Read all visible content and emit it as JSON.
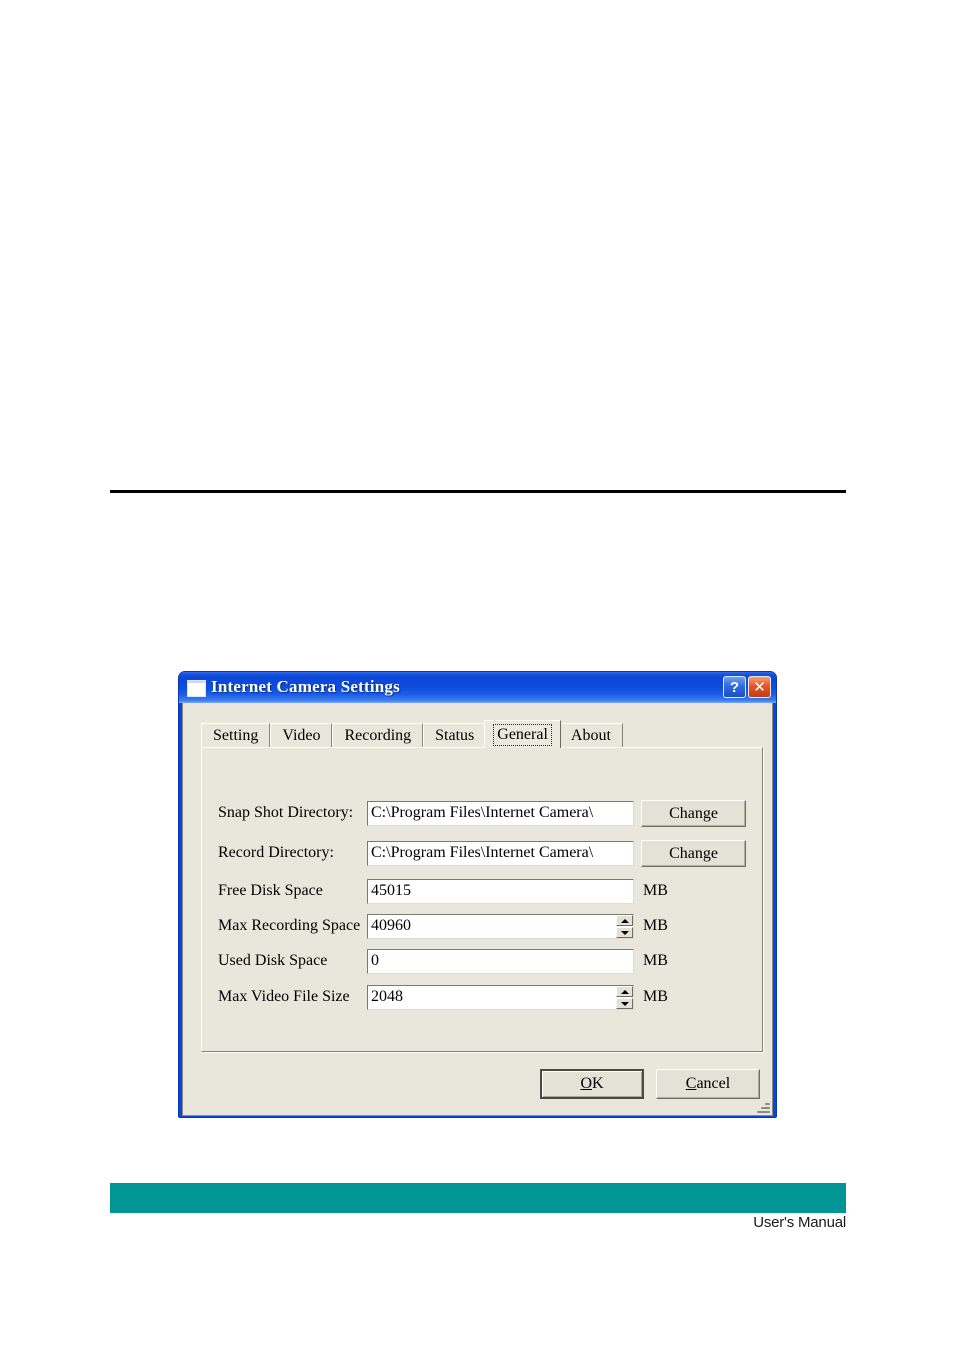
{
  "page": {
    "footer_label": "User's Manual",
    "footer_bar_color": "#019596"
  },
  "dialog": {
    "title": "Internet Camera Settings",
    "window_icon": "window-icon",
    "help_button": "?",
    "close_button": "✕",
    "tabs": [
      {
        "label": "Setting",
        "selected": false
      },
      {
        "label": "Video",
        "selected": false
      },
      {
        "label": "Recording",
        "selected": false
      },
      {
        "label": "Status",
        "selected": false
      },
      {
        "label": "General",
        "selected": true
      },
      {
        "label": "About",
        "selected": false
      }
    ],
    "fields": [
      {
        "label": "Snap Shot Directory:",
        "value": "C:\\Program Files\\Internet Camera\\",
        "unit": "",
        "button": "Change",
        "spinner": false
      },
      {
        "label": "Record Directory:",
        "value": "C:\\Program Files\\Internet Camera\\",
        "unit": "",
        "button": "Change",
        "spinner": false
      },
      {
        "label": "Free Disk Space",
        "value": "45015",
        "unit": "MB",
        "button": "",
        "spinner": false
      },
      {
        "label": "Max Recording Space",
        "value": "40960",
        "unit": "MB",
        "button": "",
        "spinner": true
      },
      {
        "label": "Used Disk Space",
        "value": "0",
        "unit": "MB",
        "button": "",
        "spinner": false
      },
      {
        "label": "Max Video File Size",
        "value": "2048",
        "unit": "MB",
        "button": "",
        "spinner": true
      }
    ],
    "actions": {
      "ok": {
        "accel": "O",
        "rest": "K"
      },
      "cancel": {
        "accel": "C",
        "rest": "ancel"
      }
    }
  }
}
